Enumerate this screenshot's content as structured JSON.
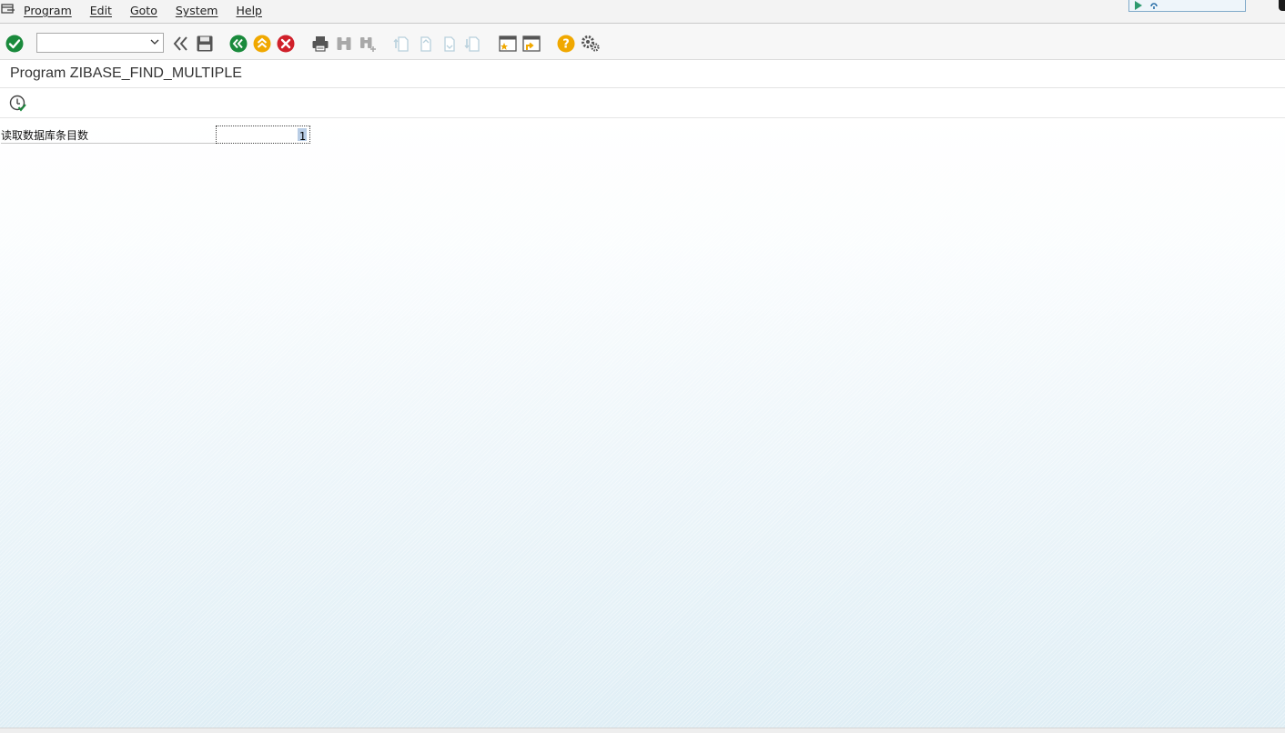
{
  "menubar": {
    "items": [
      "Program",
      "Edit",
      "Goto",
      "System",
      "Help"
    ]
  },
  "toolbar": {
    "command_field_value": "",
    "buttons": [
      "enter",
      "back-double",
      "save",
      "back",
      "exit",
      "cancel",
      "print",
      "find",
      "find-next",
      "first-page",
      "previous-page",
      "next-page",
      "last-page",
      "create-session",
      "create-shortcut",
      "help",
      "customize-layout"
    ],
    "colors": {
      "green": "#1a8a3c",
      "yellow": "#f0a800",
      "red": "#d0202a",
      "gray": "#555555",
      "disabled": "#b8d0dc"
    }
  },
  "title": {
    "text": "Program ZIBASE_FIND_MULTIPLE"
  },
  "selection": {
    "param_label": "读取数据库条目数",
    "param_value": "1"
  }
}
